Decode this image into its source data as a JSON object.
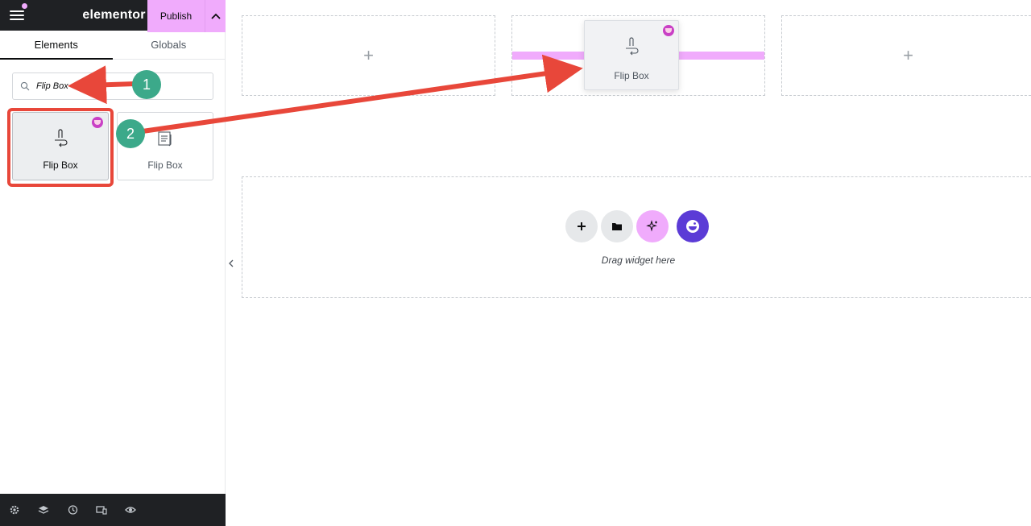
{
  "app": {
    "logo_text": "elementor"
  },
  "panel": {
    "tabs": [
      {
        "label": "Elements"
      },
      {
        "label": "Globals"
      }
    ],
    "search": {
      "value": "Flip Box"
    },
    "widgets": [
      {
        "label": "Flip Box",
        "icon": "flip-box-icon",
        "pro": true,
        "selected": true
      },
      {
        "label": "Flip Box",
        "icon": "flip-box-icon",
        "pro": false
      }
    ]
  },
  "bottom_bar": {
    "icons": [
      "gear-icon",
      "layers-icon",
      "history-icon",
      "responsive-icon",
      "eye-icon"
    ],
    "publish_label": "Publish"
  },
  "canvas": {
    "drag_ghost_label": "Flip Box",
    "dropzone_text": "Drag widget here"
  },
  "annotations": {
    "step1": "1",
    "step2": "2",
    "arrow_color": "#e8473a",
    "callout_color": "#3ca98a"
  },
  "colors": {
    "accent_pink": "#f0abfc",
    "pro_badge": "#c940c5",
    "kit_purple": "#5b3bd6",
    "topbar": "#1f2124"
  }
}
